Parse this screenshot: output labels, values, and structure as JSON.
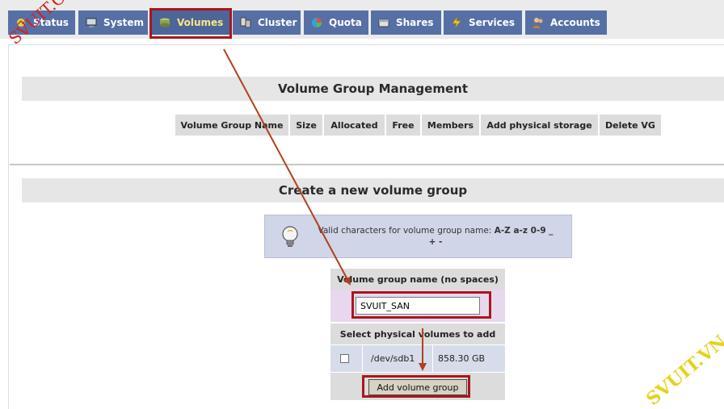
{
  "nav": {
    "tabs": [
      {
        "label": "Status",
        "icon": "status-icon"
      },
      {
        "label": "System",
        "icon": "system-icon"
      },
      {
        "label": "Volumes",
        "icon": "volumes-icon"
      },
      {
        "label": "Cluster",
        "icon": "cluster-icon"
      },
      {
        "label": "Quota",
        "icon": "quota-icon"
      },
      {
        "label": "Shares",
        "icon": "shares-icon"
      },
      {
        "label": "Services",
        "icon": "services-icon"
      },
      {
        "label": "Accounts",
        "icon": "accounts-icon"
      }
    ],
    "active_tab": "Volumes"
  },
  "vg_management": {
    "title": "Volume Group Management",
    "columns": [
      "Volume Group Name",
      "Size",
      "Allocated",
      "Free",
      "Members",
      "Add physical storage",
      "Delete VG"
    ]
  },
  "create_vg": {
    "title": "Create a new volume group",
    "info_prefix": "Valid characters for volume group name: ",
    "info_chars": "A-Z a-z 0-9 _",
    "info_chars_2": "+ -",
    "name_label": "Volume group name (no spaces)",
    "name_value": "SVUIT_SAN",
    "pv_label": "Select physical volumes to add",
    "physical_volumes": [
      {
        "device": "/dev/sdb1",
        "size": "858.30 GB",
        "checked": false
      }
    ],
    "submit_label": "Add volume group"
  },
  "watermarks": {
    "left": "SVUIT.COM",
    "right": "SVUIT.VN"
  },
  "colors": {
    "tab_bg": "#5670a6",
    "active_tab_text": "#ffe680",
    "highlight_frame": "#a8171d",
    "annotation_arrow": "#b0401f"
  }
}
